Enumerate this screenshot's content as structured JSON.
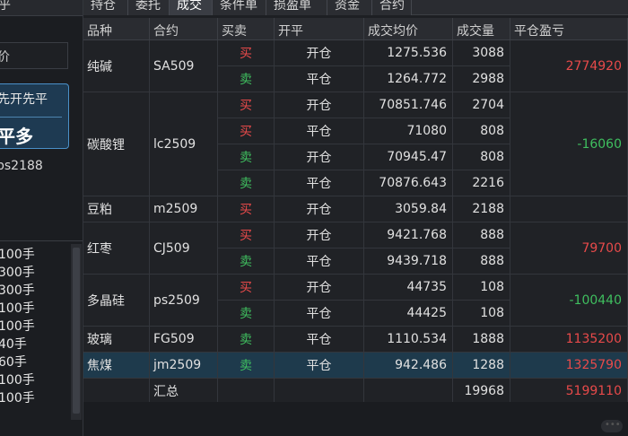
{
  "left_panel": {
    "top_label": "乎",
    "price_label": "价",
    "button_line1": "先开先平",
    "button_line2": "平多",
    "code": "ps2188",
    "list_items": [
      "100手",
      "300手",
      "300手",
      "100手",
      "100手",
      "40手",
      "60手",
      "100手",
      "100手"
    ]
  },
  "tabs": [
    {
      "label": "持仓",
      "active": false
    },
    {
      "label": "委托",
      "active": false
    },
    {
      "label": "成交",
      "active": true
    },
    {
      "label": "条件单",
      "active": false
    },
    {
      "label": "损盈单",
      "active": false
    },
    {
      "label": "资金",
      "active": false
    },
    {
      "label": "合约",
      "active": false
    }
  ],
  "table": {
    "headers": [
      "品种",
      "合约",
      "买卖",
      "开平",
      "成交均价",
      "成交量",
      "平仓盈亏"
    ],
    "groups": [
      {
        "product": "纯碱",
        "contract": "SA509",
        "pnl": "2774920",
        "pnl_color": "red",
        "selected": false,
        "rows": [
          {
            "side": "买",
            "open_close": "开仓",
            "avg_price": "1275.536",
            "volume": "3088"
          },
          {
            "side": "卖",
            "open_close": "平仓",
            "avg_price": "1264.772",
            "volume": "2988"
          }
        ]
      },
      {
        "product": "碳酸锂",
        "contract": "lc2509",
        "pnl": "-16060",
        "pnl_color": "green",
        "selected": false,
        "rows": [
          {
            "side": "买",
            "open_close": "开仓",
            "avg_price": "70851.746",
            "volume": "2704"
          },
          {
            "side": "买",
            "open_close": "平仓",
            "avg_price": "71080",
            "volume": "808"
          },
          {
            "side": "卖",
            "open_close": "开仓",
            "avg_price": "70945.47",
            "volume": "808"
          },
          {
            "side": "卖",
            "open_close": "平仓",
            "avg_price": "70876.643",
            "volume": "2216"
          }
        ]
      },
      {
        "product": "豆粕",
        "contract": "m2509",
        "pnl": "",
        "pnl_color": "red",
        "selected": false,
        "rows": [
          {
            "side": "买",
            "open_close": "开仓",
            "avg_price": "3059.84",
            "volume": "2188"
          }
        ]
      },
      {
        "product": "红枣",
        "contract": "CJ509",
        "pnl": "79700",
        "pnl_color": "red",
        "selected": false,
        "rows": [
          {
            "side": "买",
            "open_close": "开仓",
            "avg_price": "9421.768",
            "volume": "888"
          },
          {
            "side": "卖",
            "open_close": "平仓",
            "avg_price": "9439.718",
            "volume": "888"
          }
        ]
      },
      {
        "product": "多晶硅",
        "contract": "ps2509",
        "pnl": "-100440",
        "pnl_color": "green",
        "selected": false,
        "rows": [
          {
            "side": "买",
            "open_close": "开仓",
            "avg_price": "44735",
            "volume": "108"
          },
          {
            "side": "卖",
            "open_close": "平仓",
            "avg_price": "44425",
            "volume": "108"
          }
        ]
      },
      {
        "product": "玻璃",
        "contract": "FG509",
        "pnl": "1135200",
        "pnl_color": "red",
        "selected": false,
        "rows": [
          {
            "side": "卖",
            "open_close": "平仓",
            "avg_price": "1110.534",
            "volume": "1888"
          }
        ]
      },
      {
        "product": "焦煤",
        "contract": "jm2509",
        "pnl": "1325790",
        "pnl_color": "red",
        "selected": true,
        "rows": [
          {
            "side": "卖",
            "open_close": "平仓",
            "avg_price": "942.486",
            "volume": "1288"
          }
        ]
      }
    ],
    "total": {
      "label": "汇总",
      "volume": "19968",
      "pnl": "5199110",
      "pnl_color": "red"
    }
  },
  "colors": {
    "buy": "#e84a4a",
    "sell": "#3fbf5f",
    "accent": "#4a90c8"
  }
}
